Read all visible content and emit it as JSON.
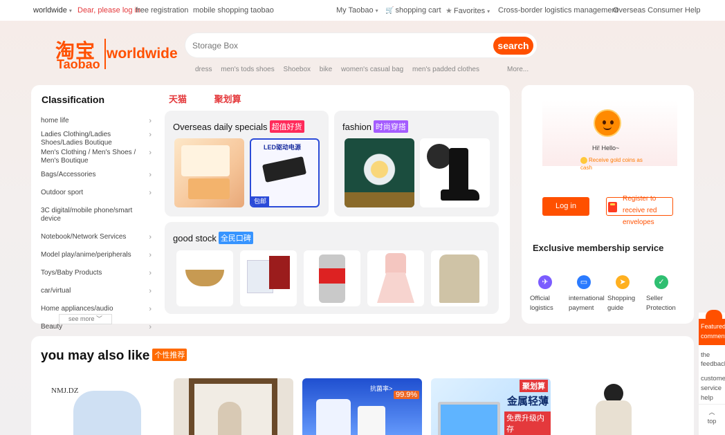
{
  "topbar": {
    "region": "worldwide",
    "login_prompt": "Dear, please log in",
    "register": "free registration",
    "mobile": "mobile shopping taobao",
    "my_taobao": "My Taobao",
    "cart": "shopping cart",
    "favorites": "Favorites",
    "logistics": "Cross-border logistics management",
    "help": "Overseas Consumer Help"
  },
  "logo": {
    "cn": "淘宝",
    "en": "Taobao",
    "suffix": "worldwide"
  },
  "search": {
    "placeholder": "Storage Box",
    "button": "search",
    "hot": [
      "dress",
      "men's tods shoes",
      "Shoebox",
      "bike",
      "women's casual bag",
      "men's padded clothes"
    ],
    "more": "More..."
  },
  "classification": {
    "title": "Classification",
    "brand_tabs": [
      "天猫",
      "聚划算"
    ],
    "items": [
      "home life",
      "Ladies Clothing/Ladies Shoes/Ladies Boutique",
      "Men's Clothing / Men's Shoes / Men's Boutique",
      "Bags/Accessories",
      "Outdoor sport",
      "3C digital/mobile phone/smart device",
      "Notebook/Network Services",
      "Model play/anime/peripherals",
      "Toys/Baby Products",
      "car/virtual",
      "Home appliances/audio",
      "Beauty"
    ],
    "see_more": "see more"
  },
  "promos": {
    "overseas": {
      "title": "Overseas daily specials",
      "tag": "超值好货"
    },
    "fashion": {
      "title": "fashion",
      "tag": "时尚穿搭"
    },
    "good_stock": {
      "title": "good stock",
      "tag": "全民口碑"
    },
    "overseas_thumb2_label": "LED驱动电源",
    "overseas_thumb2_badge": "包邮"
  },
  "account": {
    "greeting": "Hi! Hello~",
    "gold": "Receive gold coins as cash",
    "login": "Log in",
    "register": "Register to receive red envelopes",
    "membership_title": "Exclusive membership service",
    "services": [
      {
        "label": "Official logistics",
        "icon": "logistics-icon",
        "color": "#7b5cff"
      },
      {
        "label": "international payment",
        "icon": "payment-icon",
        "color": "#2b7bff"
      },
      {
        "label": "Shopping guide",
        "icon": "guide-icon",
        "color": "#ffb020"
      },
      {
        "label": "Seller Protection",
        "icon": "protection-icon",
        "color": "#2fbf71"
      }
    ]
  },
  "recommend": {
    "title": "you may also like",
    "tag": "个性推荐",
    "item_texts": [
      "NMJ.DZ",
      "抗菌率>",
      "99.9%",
      "聚划算",
      "金属轻薄",
      "免费升级内存"
    ]
  },
  "side": {
    "featured": "Featured comments",
    "feedback": "the feedback",
    "service": "customer service help",
    "top": "top"
  },
  "colors": {
    "brand": "#ff5000",
    "red": "#e4393c"
  }
}
